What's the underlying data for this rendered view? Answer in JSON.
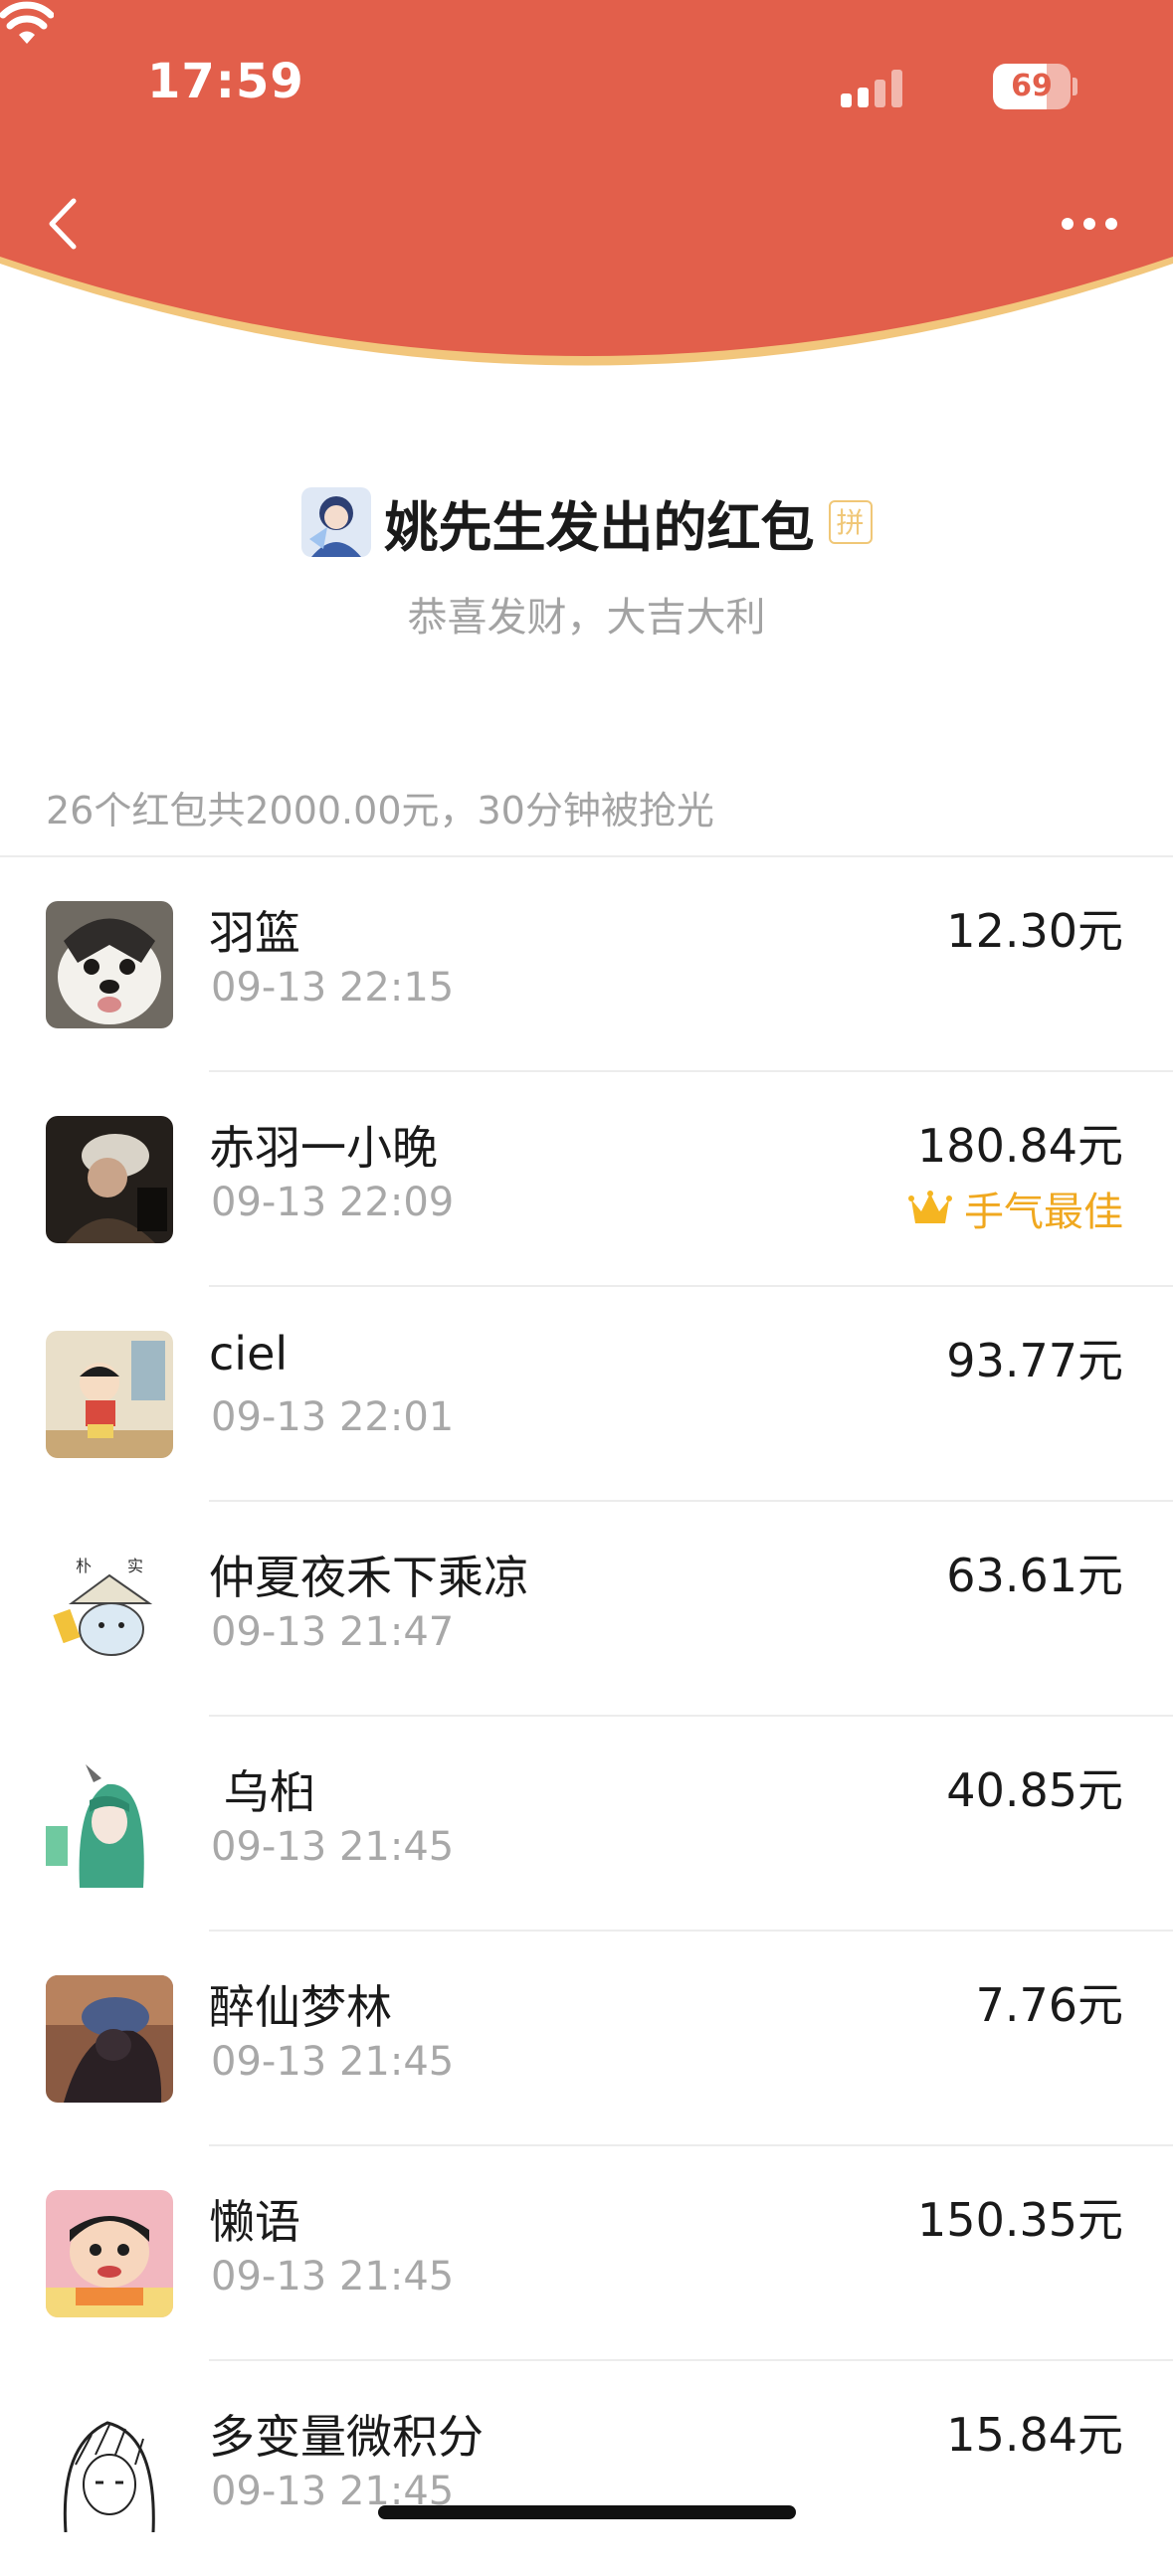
{
  "status_bar": {
    "time": "17:59",
    "battery": "69",
    "battery_level": 0.69
  },
  "header": {
    "bg_color": "#e25f4b",
    "rim_color": "#f2c67c"
  },
  "sender": {
    "title": "姚先生发出的红包",
    "badge": "拼",
    "blessing": "恭喜发财，大吉大利"
  },
  "summary": "26个红包共2000.00元，30分钟被抢光",
  "best_label": "手气最佳",
  "recipients": [
    {
      "name": "羽篮",
      "time": "09-13 22:15",
      "amount": "12.30元"
    },
    {
      "name": "赤羽一小晚",
      "time": "09-13 22:09",
      "amount": "180.84元",
      "best": true
    },
    {
      "name": "ciel",
      "time": "09-13 22:01",
      "amount": "93.77元"
    },
    {
      "name": "仲夏夜禾下乘凉",
      "time": "09-13 21:47",
      "amount": "63.61元"
    },
    {
      "name": " 乌桕",
      "time": "09-13 21:45",
      "amount": "40.85元"
    },
    {
      "name": "醉仙梦林",
      "time": "09-13 21:45",
      "amount": "7.76元"
    },
    {
      "name": "懒语",
      "time": "09-13 21:45",
      "amount": "150.35元"
    },
    {
      "name": "多变量微积分",
      "time": "09-13 21:45",
      "amount": "15.84元"
    }
  ]
}
